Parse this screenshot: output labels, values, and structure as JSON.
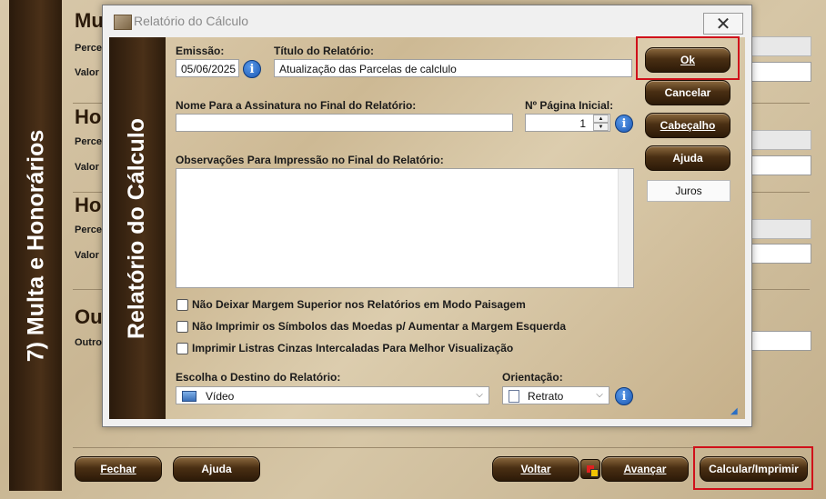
{
  "background": {
    "side_title": "7) Multa e Honorários",
    "sections": [
      {
        "title": "Mu",
        "label1": "Perce",
        "label2": "Valor"
      },
      {
        "title": "Ho",
        "label1": "Perce",
        "label2": "Valor"
      },
      {
        "title": "Ho",
        "label1": "Perce",
        "label2": "Valor"
      },
      {
        "title": "Ou",
        "label1": "Outro"
      }
    ],
    "buttons": {
      "fechar": "Fechar",
      "ajuda": "Ajuda",
      "voltar": "Voltar",
      "avancar": "Avançar",
      "calcular": "Calcular/Imprimir"
    }
  },
  "dialog": {
    "title": "Relatório do Cálculo",
    "side_title": "Relatório do Cálculo",
    "emissao_label": "Emissão:",
    "emissao_value": "05/06/2025",
    "titulo_label": "Título do Relatório:",
    "titulo_value": "Atualização das Parcelas de calclulo",
    "nome_label": "Nome Para a Assinatura no Final do Relatório:",
    "nome_value": "",
    "pagina_label": "Nº Página Inicial:",
    "pagina_value": "1",
    "obs_label": "Observações Para Impressão no Final do Relatório:",
    "obs_value": "",
    "checkboxes": [
      "Não Deixar Margem Superior nos Relatórios em Modo Paisagem",
      "Não Imprimir os Símbolos das Moedas p/ Aumentar a Margem Esquerda",
      "Imprimir Listras Cinzas Intercaladas Para Melhor Visualização"
    ],
    "destino_label": "Escolha o Destino do Relatório:",
    "destino_value": "Vídeo",
    "orientacao_label": "Orientação:",
    "orientacao_value": "Retrato",
    "buttons": {
      "ok": "Ok",
      "cancelar": "Cancelar",
      "cabecalho": "Cabeçalho",
      "ajuda": "Ajuda",
      "juros": "Juros"
    },
    "info_glyph": "i",
    "close_glyph": "✕"
  }
}
